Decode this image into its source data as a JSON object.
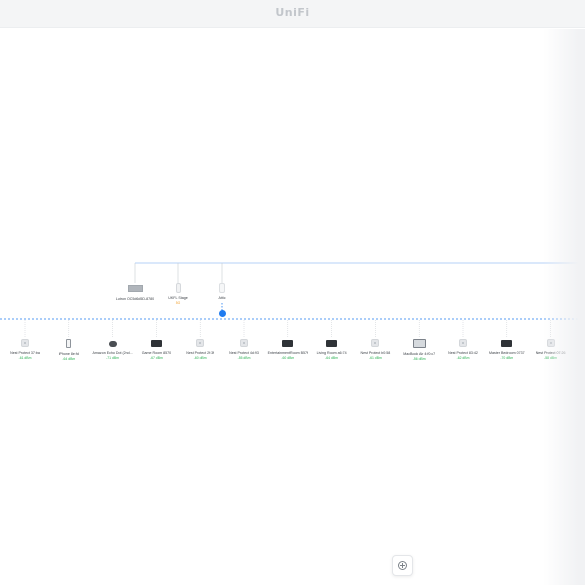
{
  "app": {
    "logo_text": "UniFi"
  },
  "colors": {
    "link": "#1f7bf0",
    "wired": "#c8ccd1",
    "signal_good": "#29b050",
    "signal_warn": "#f0a030"
  },
  "top_devices": [
    {
      "name": "Lutron OC5d6d5D-8780",
      "detail": "",
      "icon": "switch-icon"
    },
    {
      "name": "UKFL Stage",
      "detail": "5G",
      "icon": "access-point-icon"
    },
    {
      "name": "Attic",
      "detail": "",
      "icon": "router-icon"
    }
  ],
  "clients": [
    {
      "name": "Nest Protect 37:ba",
      "signal": "-61 dBm",
      "icon": "sensor-icon"
    },
    {
      "name": "iPhone 8e:fd",
      "signal": "-64 dBm",
      "icon": "phone-icon"
    },
    {
      "name": "Amazon Echo Dot (2nd...",
      "signal": "-71 dBm",
      "icon": "speaker-icon"
    },
    {
      "name": "Game Room 8570",
      "signal": "-67 dBm",
      "icon": "tv-icon"
    },
    {
      "name": "Nest Protect 2f:3f",
      "signal": "-60 dBm",
      "icon": "sensor-icon"
    },
    {
      "name": "Nest Protect 4d:93",
      "signal": "-55 dBm",
      "icon": "sensor-icon"
    },
    {
      "name": "EntertainmentRoom B57f",
      "signal": "-60 dBm",
      "icon": "tv-icon"
    },
    {
      "name": "Living Room a6:74",
      "signal": "-64 dBm",
      "icon": "tv-icon"
    },
    {
      "name": "Nest Protect b0:58",
      "signal": "-61 dBm",
      "icon": "sensor-icon"
    },
    {
      "name": "MacBook Air 4:f0:c7",
      "signal": "-56 dBm",
      "icon": "laptop-icon"
    },
    {
      "name": "Nest Protect 83:42",
      "signal": "-62 dBm",
      "icon": "sensor-icon"
    },
    {
      "name": "Master Bedroom 0737",
      "signal": "-70 dBm",
      "icon": "tv-icon"
    },
    {
      "name": "Nest Protect 07:26",
      "signal": "-58 dBm",
      "icon": "sensor-icon"
    }
  ],
  "controls": {
    "zoom_in_icon": "plus-circle-icon"
  }
}
